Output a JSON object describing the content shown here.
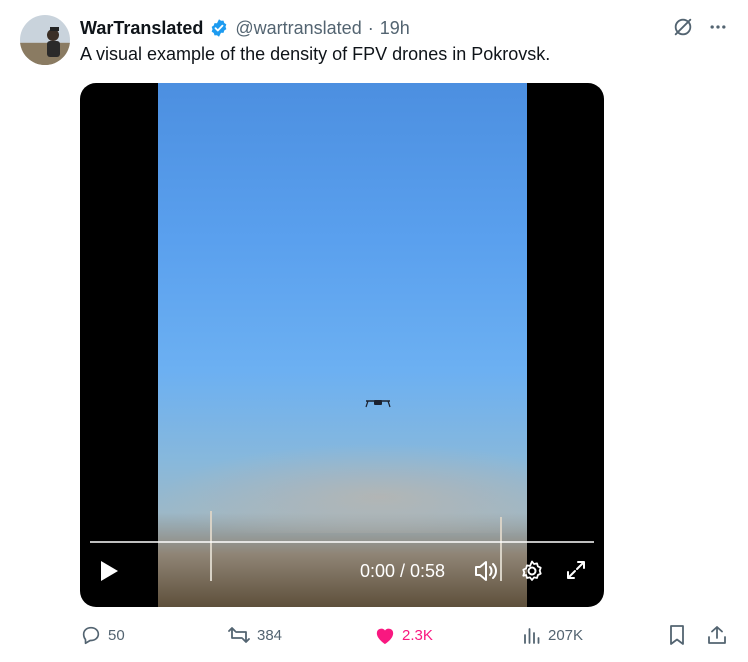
{
  "tweet": {
    "display_name": "WarTranslated",
    "handle": "@wartranslated",
    "separator": "·",
    "time": "19h",
    "text": "A visual example of the density of FPV drones in Pokrovsk."
  },
  "video": {
    "current_time": "0:00",
    "duration": "0:58",
    "time_label": "0:00 / 0:58",
    "progress_fraction": 0
  },
  "actions": {
    "replies": "50",
    "reposts": "384",
    "likes": "2.3K",
    "views": "207K"
  },
  "colors": {
    "verified": "#1d9bf0",
    "like_active": "#f91880",
    "muted_text": "#536471"
  },
  "icons": [
    "grok-icon",
    "more-icon",
    "play-icon",
    "volume-icon",
    "settings-icon",
    "fullscreen-icon",
    "reply-icon",
    "repost-icon",
    "like-icon",
    "views-icon",
    "bookmark-icon",
    "share-icon"
  ]
}
